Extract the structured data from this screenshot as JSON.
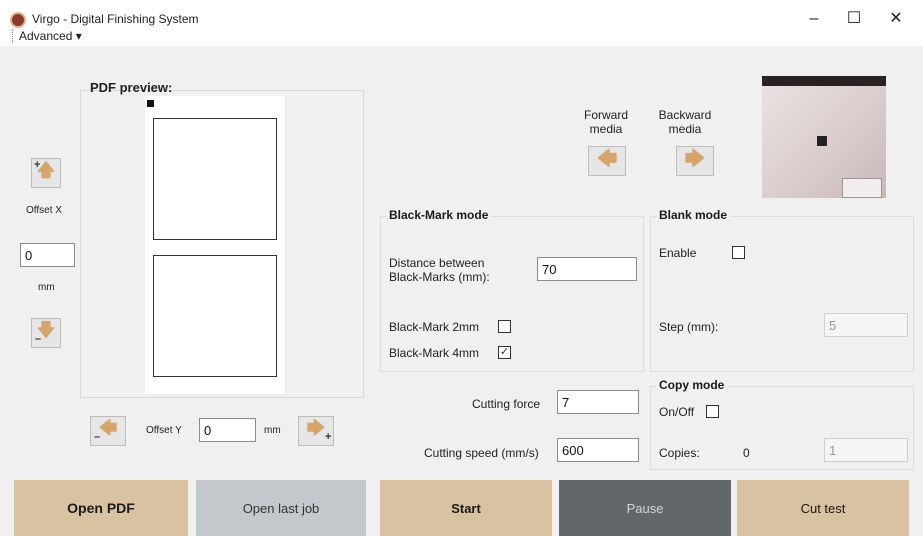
{
  "window": {
    "title": "Virgo - Digital Finishing System",
    "controls": {
      "minimize": "–",
      "maximize": "☐",
      "close": "✕"
    }
  },
  "menu": {
    "advanced": "Advanced ▾"
  },
  "pdf_preview": {
    "title": "PDF preview:"
  },
  "offset_x": {
    "label": "Offset X",
    "value": "0",
    "unit": "mm"
  },
  "offset_y": {
    "label": "Offset Y",
    "value": "0",
    "unit": "mm"
  },
  "media": {
    "forward_label": "Forward\nmedia",
    "backward_label": "Backward\nmedia"
  },
  "black_mark": {
    "title": "Black-Mark mode",
    "distance_label": "Distance between\nBlack-Marks (mm):",
    "distance_value": "70",
    "mark_2mm_label": "Black-Mark 2mm",
    "mark_2mm_checked": false,
    "mark_4mm_label": "Black-Mark 4mm",
    "mark_4mm_checked": true
  },
  "blank": {
    "title": "Blank mode",
    "enable_label": "Enable",
    "enable_checked": false,
    "step_label": "Step (mm):",
    "step_value": "5"
  },
  "cutting": {
    "force_label": "Cutting force",
    "force_value": "7",
    "speed_label": "Cutting speed (mm/s)",
    "speed_value": "600"
  },
  "copy": {
    "title": "Copy mode",
    "onoff_label": "On/Off",
    "onoff_checked": false,
    "copies_label": "Copies:",
    "copies_count": "0",
    "copies_value": "1"
  },
  "bottom": {
    "open_pdf": "Open PDF",
    "open_last_job": "Open last job",
    "start": "Start",
    "pause": "Pause",
    "cut_test": "Cut test"
  },
  "colors": {
    "tan": "#d9c2a1",
    "gray_button": "#c4c8cc",
    "dark_button": "#63676c",
    "arrow": "#d7a56a"
  },
  "icons": {
    "up": "up-arrow-icon",
    "down": "down-arrow-icon",
    "left": "left-arrow-icon",
    "right": "right-arrow-icon"
  }
}
